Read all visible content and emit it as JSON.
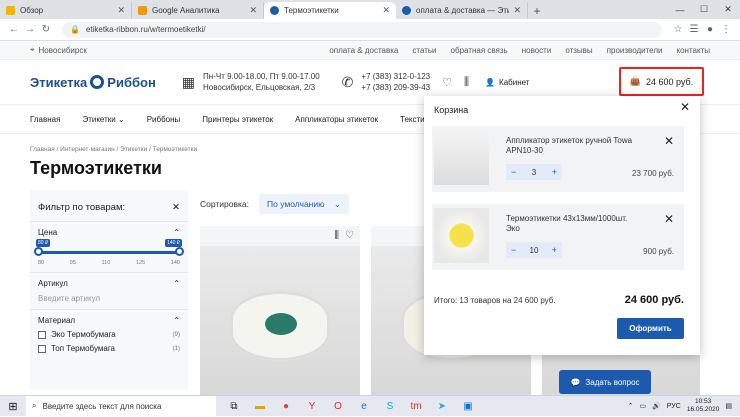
{
  "browser": {
    "tabs": [
      {
        "label": "Обзор",
        "fav": "#f4b400",
        "active": false
      },
      {
        "label": "Google Аналитика",
        "fav": "#f29900",
        "active": false
      },
      {
        "label": "Термоэтикетки",
        "fav": "#1b5aad",
        "active": true
      },
      {
        "label": "оплата & доставка — Этикетка Ри...",
        "fav": "#1b5aad",
        "active": false
      }
    ],
    "url": "etiketka-ribbon.ru/w/termoetiketki/"
  },
  "top": {
    "city": "Новосибирск",
    "links": [
      "оплата & доставка",
      "статьи",
      "обратная связь",
      "новости",
      "отзывы",
      "производители",
      "контакты"
    ]
  },
  "header": {
    "logo_left": "Этикетка",
    "logo_right": "Риббон",
    "hours1": "Пн-Чт 9.00-18.00, Пт 9.00-17.00",
    "hours2": "Новосибирск, Ельцовская, 2/3",
    "phone1": "+7 (383) 312-0-123",
    "phone2": "+7 (383) 209-39-43",
    "cabinet": "Кабинет",
    "cart_total": "24 600 руб."
  },
  "nav": [
    "Главная",
    "Этикетки",
    "Риббоны",
    "Принтеры этикеток",
    "Аппликаторы этикеток",
    "Тексти..."
  ],
  "breadcrumbs": "Главная / Интернет-магазин / Этикетки / Термоэтикетки",
  "page_title": "Термоэтикетки",
  "filter": {
    "title": "Фильтр по товарам:",
    "price_label": "Цена",
    "min_badge": "80 ₽",
    "max_badge": "140 ₽",
    "ticks": [
      "80",
      "95",
      "110",
      "125",
      "140"
    ],
    "article_label": "Артикул",
    "article_placeholder": "Введите артикул",
    "material_label": "Материал",
    "materials": [
      {
        "name": "Эко Термобумага",
        "count": "(9)"
      },
      {
        "name": "Топ Термобумага",
        "count": "(1)"
      }
    ]
  },
  "sort": {
    "label": "Сортировка:",
    "value": "По умолчанию"
  },
  "cart_popup": {
    "title": "Корзина",
    "items": [
      {
        "name": "Аппликатор этикеток ручной Towa APN10-30",
        "qty": "3",
        "price": "23 700 руб."
      },
      {
        "name": "Термоэтикетки 43х13мм/1000шт. Эко",
        "qty": "10",
        "price": "900 руб."
      }
    ],
    "total_text": "Итого: 13 товаров на 24 600 руб.",
    "total_sum": "24 600 руб.",
    "order_btn": "Оформить"
  },
  "ask_btn": "Задать вопрос",
  "taskbar": {
    "search": "Введите здесь текст для поиска",
    "lang": "РУС",
    "time": "10:53",
    "date": "16.05.2020"
  }
}
